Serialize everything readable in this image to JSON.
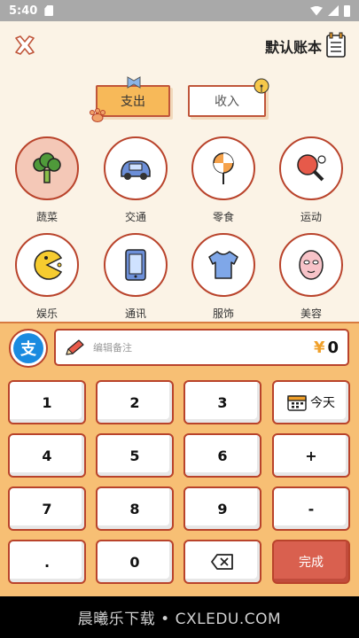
{
  "status_bar": {
    "time": "5:40"
  },
  "header": {
    "book_title": "默认账本"
  },
  "tabs": {
    "expense": "支出",
    "income": "收入"
  },
  "categories": [
    {
      "label": "蔬菜",
      "icon": "broccoli-icon"
    },
    {
      "label": "交通",
      "icon": "car-icon"
    },
    {
      "label": "零食",
      "icon": "lollipop-icon"
    },
    {
      "label": "运动",
      "icon": "ping-pong-icon"
    },
    {
      "label": "娱乐",
      "icon": "pacman-icon"
    },
    {
      "label": "通讯",
      "icon": "phone-icon"
    },
    {
      "label": "服饰",
      "icon": "tshirt-icon"
    },
    {
      "label": "美容",
      "icon": "face-mask-icon"
    }
  ],
  "keypad": {
    "pay_icon_label": "支",
    "note_placeholder": "编辑备注",
    "currency": "¥",
    "amount": "0",
    "keys": {
      "k1": "1",
      "k2": "2",
      "k3": "3",
      "today": "今天",
      "k4": "4",
      "k5": "5",
      "k6": "6",
      "plus": "+",
      "k7": "7",
      "k8": "8",
      "k9": "9",
      "minus": "-",
      "dot": ".",
      "k0": "0",
      "done": "完成"
    }
  },
  "watermark": "晨曦乐下载 • CXLEDU.COM",
  "colors": {
    "accent": "#f7b959",
    "border": "#b9432b",
    "keypad_bg": "#f7bf74",
    "done": "#d9604f"
  }
}
